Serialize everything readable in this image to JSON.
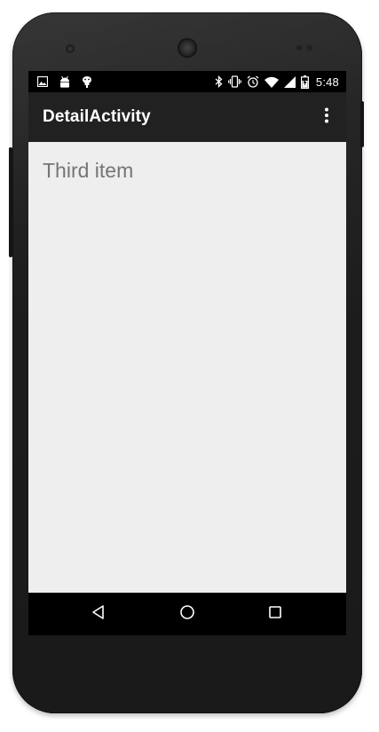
{
  "status_bar": {
    "time": "5:48",
    "left_icons": [
      "image-icon",
      "android-icon",
      "debug-icon"
    ],
    "right_icons": [
      "bluetooth-icon",
      "vibrate-icon",
      "alarm-icon",
      "wifi-icon",
      "cell-signal-icon",
      "battery-charging-icon"
    ]
  },
  "app_bar": {
    "title": "DetailActivity",
    "overflow_icon": "more-vert-icon"
  },
  "content": {
    "detail_text": "Third item"
  },
  "nav_bar": {
    "buttons": [
      "back-icon",
      "home-icon",
      "recents-icon"
    ]
  },
  "colors": {
    "app_bar": "#212121",
    "status_bar": "#000000",
    "content_background": "#eeeeee",
    "detail_text": "#757575",
    "nav_bar": "#000000",
    "device_body": "#1c1c1c"
  }
}
